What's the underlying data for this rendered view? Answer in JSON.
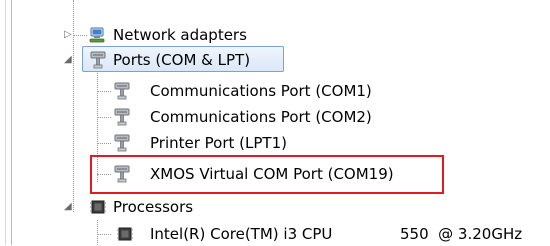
{
  "tree": {
    "network_adapters": {
      "label": "Network adapters",
      "icon": "network-adapter-icon",
      "expanded": false
    },
    "ports": {
      "label": "Ports (COM & LPT)",
      "icon": "port-connector-icon",
      "expanded": true,
      "selected": true,
      "children": [
        {
          "label": "Communications Port (COM1)",
          "icon": "port-connector-icon"
        },
        {
          "label": "Communications Port (COM2)",
          "icon": "port-connector-icon"
        },
        {
          "label": "Printer Port (LPT1)",
          "icon": "port-connector-icon"
        },
        {
          "label": "XMOS Virtual COM Port (COM19)",
          "icon": "port-connector-icon",
          "highlighted": true
        }
      ]
    },
    "processors": {
      "label": "Processors",
      "icon": "processor-chip-icon",
      "expanded": true,
      "children": [
        {
          "label": "Intel(R) Core(TM) i3 CPU",
          "speed": "550  @ 3.20GHz",
          "icon": "processor-chip-icon"
        }
      ]
    }
  },
  "colors": {
    "highlight_frame": "#e01b24",
    "selection_border": "#7da2ce",
    "tree_lines": "#9a9a9a"
  }
}
